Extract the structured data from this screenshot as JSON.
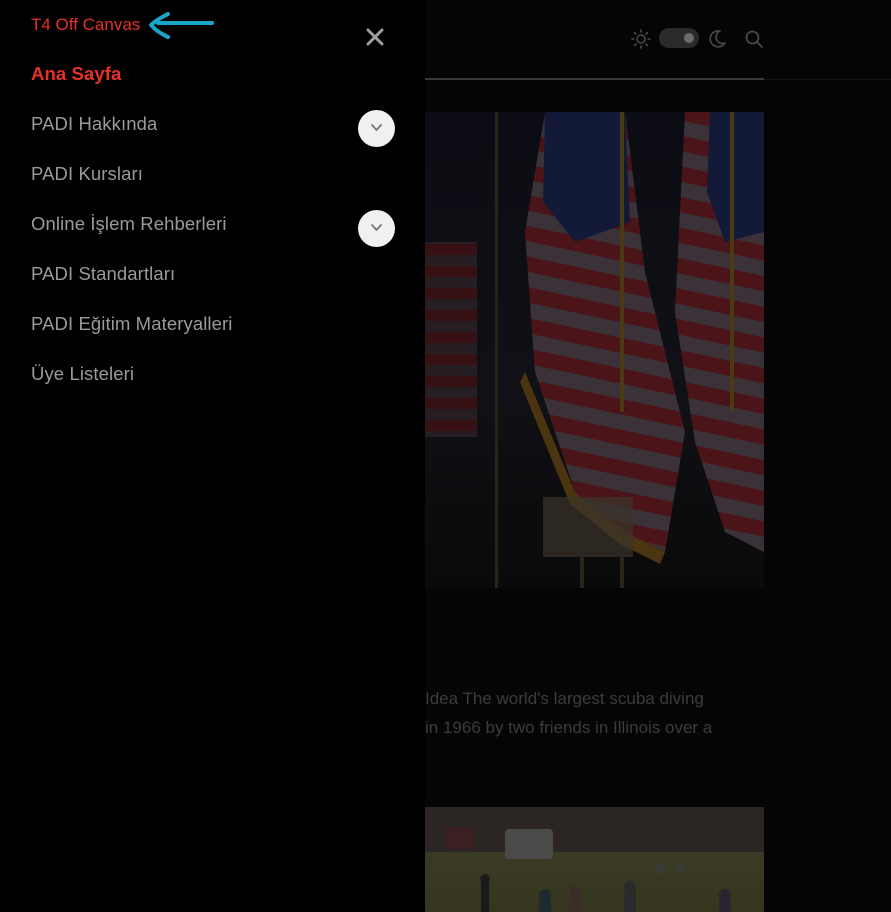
{
  "offcanvas": {
    "title": "T4 Off Canvas",
    "close_icon": "close-icon",
    "accent_color": "#e8302a",
    "arrow_color": "#1aa6c9",
    "menu": [
      {
        "label": "Ana Sayfa",
        "active": true,
        "expandable": false
      },
      {
        "label": "PADI Hakkında",
        "active": false,
        "expandable": true
      },
      {
        "label": "PADI Kursları",
        "active": false,
        "expandable": false
      },
      {
        "label": "Online İşlem Rehberleri",
        "active": false,
        "expandable": true
      },
      {
        "label": "PADI Standartları",
        "active": false,
        "expandable": false
      },
      {
        "label": "PADI Eğitim Materyalleri",
        "active": false,
        "expandable": false
      },
      {
        "label": "Üye Listeleri",
        "active": false,
        "expandable": false
      }
    ]
  },
  "header": {
    "icons": [
      "sun-icon",
      "theme-toggle",
      "moon-icon",
      "search-icon"
    ]
  },
  "article": {
    "excerpt_line1": "Idea The world's largest scuba diving",
    "excerpt_line2": "in 1966 by two friends in Illinois over a"
  }
}
